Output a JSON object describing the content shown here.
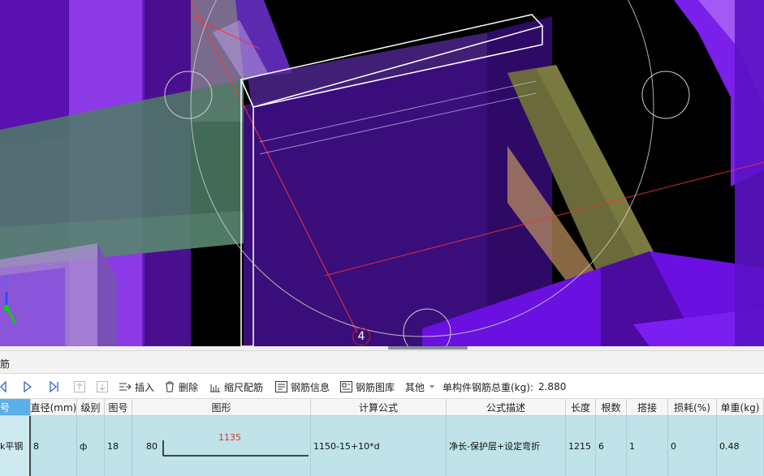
{
  "viewport": {
    "axis_labels": {
      "z": "Z",
      "y": "Y"
    },
    "grid_bubble_label": "4"
  },
  "panel": {
    "title": "筋"
  },
  "toolbar": {
    "insert_label": "插入",
    "delete_label": "删除",
    "scale_label": "缩尺配筋",
    "rebar_info_label": "钢筋信息",
    "rebar_library_label": "钢筋图库",
    "other_label": "其他",
    "total_weight_label": "单构件钢筋总重(kg):",
    "total_weight_value": "2.880"
  },
  "table": {
    "headers": [
      "号",
      "直径(mm)",
      "级别",
      "图号",
      "图形",
      "计算公式",
      "公式描述",
      "长度",
      "根数",
      "搭接",
      "损耗(%)",
      "单重(kg)"
    ],
    "row": {
      "name": "k平钢",
      "diameter": "8",
      "grade": "ф",
      "figure_no": "18",
      "shape_left": "80",
      "shape_length": "1135",
      "formula": "1150-15+10*d",
      "description": "净长-保护层+设定弯折",
      "length": "1215",
      "count": "6",
      "lap": "1",
      "loss": "0",
      "unit_weight": "0.48"
    }
  },
  "colors": {
    "viewport_bg": "#000000",
    "purple": "#7a1fd6",
    "header_blue": "#5ab0e8",
    "row_bg": "#bfe3e8",
    "shape_text": "#e03030"
  }
}
